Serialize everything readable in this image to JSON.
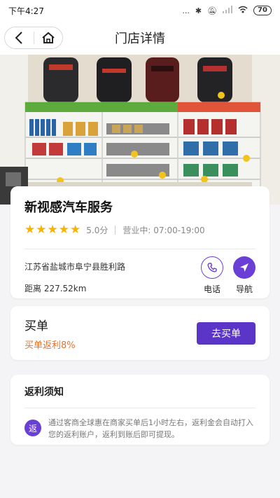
{
  "status_bar": {
    "time": "下午4:27",
    "signal_text": "...",
    "battery": "70"
  },
  "nav": {
    "title": "门店详情"
  },
  "shop": {
    "name": "新视感汽车服务",
    "rating_value": 5,
    "rating_max": 5,
    "score": "5.0分",
    "hours": "营业中: 07:00-19:00",
    "address": "江苏省盐城市阜宁县胜利路",
    "distance": "距离 227.52km",
    "phone_label": "电话",
    "navigate_label": "导航"
  },
  "buy": {
    "title": "买单",
    "rebate": "买单返利8%",
    "button": "去买单"
  },
  "notice": {
    "title": "返利须知",
    "badge": "返",
    "text": "通过客商全球惠在商家买单后1小时左右，返利金会自动打入您的返利账户，返利到账后即可提现。"
  },
  "colors": {
    "accent": "#6a3fd6",
    "rebate": "#e8722c",
    "star": "#f5b400"
  }
}
